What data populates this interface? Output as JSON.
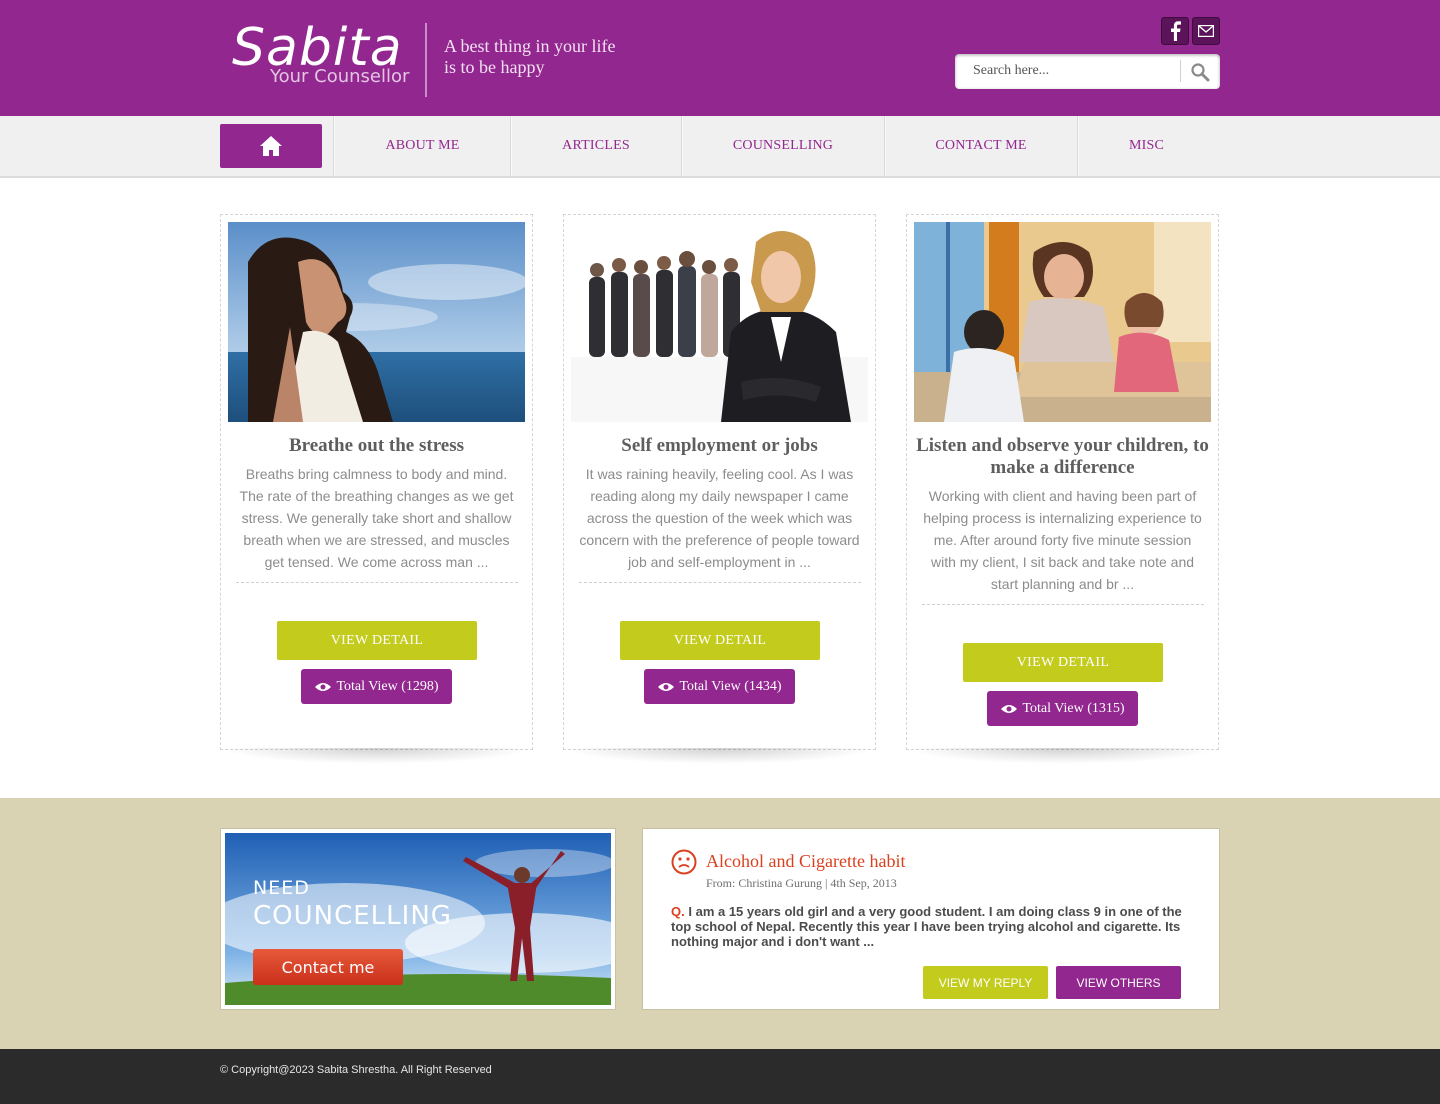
{
  "header": {
    "logo_name": "Sabita",
    "logo_sub": "Your Counsellor",
    "tagline_line1": "A best thing in your life",
    "tagline_line2": "is to be happy",
    "social_icons": [
      "facebook-icon",
      "mail-icon"
    ],
    "search_placeholder": "Search here..."
  },
  "nav": {
    "home_icon": "home-icon",
    "items": [
      {
        "label": "ABOUT ME"
      },
      {
        "label": "ARTICLES"
      },
      {
        "label": "COUNSELLING"
      },
      {
        "label": "CONTACT ME"
      },
      {
        "label": "MISC"
      }
    ]
  },
  "cards": [
    {
      "title": "Breathe out the stress",
      "text": "Breaths bring calmness to body and mind. The rate of the breathing changes as we get stress. We generally take short and shallow breath when we are stressed, and muscles get tensed. We come across man ...",
      "button": "VIEW DETAIL",
      "views": "Total View (1298)"
    },
    {
      "title": "Self employment or jobs",
      "text": "It was raining heavily, feeling cool. As I was reading along my daily newspaper I came across the question of the week which was concern with the preference of people toward job and self-employment in ...",
      "button": "VIEW DETAIL",
      "views": "Total View (1434)"
    },
    {
      "title": "Listen and observe your children, to make a difference",
      "text": "Working with client and having been part of helping process is internalizing experience to me. After around forty five minute session with my client, I sit back and take note and start planning and br ...",
      "button": "VIEW DETAIL",
      "views": "Total View (1315)"
    }
  ],
  "promo": {
    "need": "NEED",
    "councelling": "COUNCELLING",
    "button": "Contact me"
  },
  "qa": {
    "title": "Alcohol and Cigarette habit",
    "meta": "From: Christina Gurung | 4th Sep, 2013",
    "q_label": "Q.",
    "question": "I am a 15 years old girl and a very good student. I am doing class 9 in one of the top school of Nepal. Recently this year I have been trying alcohol and cigarette. Its nothing major and i don't want ...",
    "reply_button": "VIEW MY REPLY",
    "others_button": "VIEW OTHERS"
  },
  "footer": {
    "copyright": "© Copyright@2023 Sabita Shrestha. All Right Reserved"
  },
  "colors": {
    "brand_purple": "#92278f",
    "accent_lime": "#c3cb1c",
    "band_beige": "#d9d2b3",
    "footer_dark": "#2b2b2b",
    "qa_red": "#d9421f"
  }
}
